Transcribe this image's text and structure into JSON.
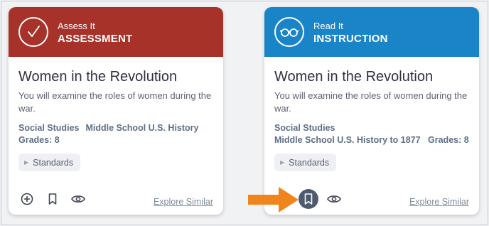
{
  "colors": {
    "assessment": "#a7322a",
    "instruction": "#1a84c8",
    "arrow": "#f0851d"
  },
  "cards": [
    {
      "kicker": "Assess It",
      "type": "ASSESSMENT",
      "icon": "check-icon",
      "title": "Women in the Revolution",
      "description": "You will examine the roles of women during the war.",
      "meta_line1_a": "Social Studies",
      "meta_line1_b": "Middle School U.S. History",
      "meta_line2": "Grades: 8",
      "standards": "Standards",
      "explore": "Explore Similar"
    },
    {
      "kicker": "Read It",
      "type": "INSTRUCTION",
      "icon": "glasses-icon",
      "title": "Women in the Revolution",
      "description": "You will examine the roles of women during the war.",
      "meta_line1_a": "Social Studies",
      "meta_line2": "Middle School U.S. History to 1877   Grades: 8",
      "standards": "Standards",
      "explore": "Explore Similar"
    }
  ]
}
